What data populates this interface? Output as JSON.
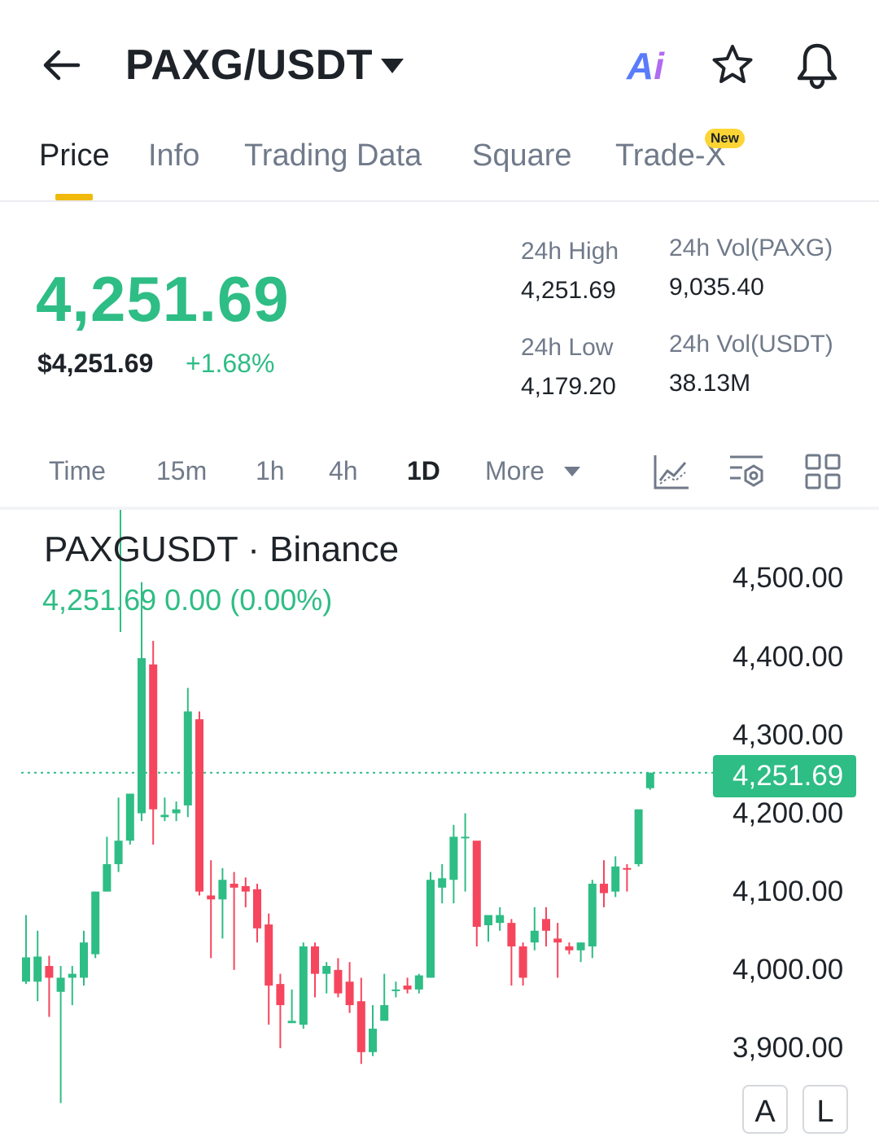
{
  "header": {
    "pair": "PAXG/USDT",
    "ai_label_a": "A",
    "ai_label_i": "i"
  },
  "tabs": [
    {
      "label": "Price",
      "active": true
    },
    {
      "label": "Info"
    },
    {
      "label": "Trading Data"
    },
    {
      "label": "Square"
    },
    {
      "label": "Trade-X",
      "badge": "New"
    }
  ],
  "price": {
    "last": "4,251.69",
    "usd": "$4,251.69",
    "change_pct": "+1.68%"
  },
  "stats": {
    "high_label": "24h High",
    "high_value": "4,251.69",
    "low_label": "24h Low",
    "low_value": "4,179.20",
    "vol_base_label": "24h Vol(PAXG)",
    "vol_base_value": "9,035.40",
    "vol_quote_label": "24h Vol(USDT)",
    "vol_quote_value": "38.13M"
  },
  "timeframes": [
    "Time",
    "15m",
    "1h",
    "4h",
    "1D",
    "More"
  ],
  "active_timeframe": "1D",
  "chart_header": {
    "title": "PAXGUSDT · Binance",
    "subtitle": "4,251.69  0.00 (0.00%)"
  },
  "scale_buttons": [
    "A",
    "L"
  ],
  "colors": {
    "up": "#2ebd85",
    "down": "#f6465d",
    "accent": "#f0b90b",
    "badge": "#fcd535"
  },
  "icons": [
    "back-arrow-icon",
    "caret-down-icon",
    "ai-icon",
    "star-icon",
    "bell-icon",
    "indicator-chart-icon",
    "chart-settings-icon",
    "grid-layout-icon"
  ],
  "chart_data": {
    "type": "candlestick",
    "title": "PAXGUSDT · Binance",
    "y_ticks": [
      "4,500.00",
      "4,400.00",
      "4,300.00",
      "4,200.00",
      "4,100.00",
      "4,000.00",
      "3,900.00"
    ],
    "y_tick_values": [
      4500,
      4400,
      4300,
      4200,
      4100,
      4000,
      3900
    ],
    "last_price_label": "4,251.69",
    "last_price_value": 4251.69,
    "grid": false,
    "candles": [
      {
        "o": 3985,
        "h": 4070,
        "l": 3982,
        "c": 4016
      },
      {
        "o": 3985,
        "h": 4050,
        "l": 3960,
        "c": 4017
      },
      {
        "o": 4005,
        "h": 4018,
        "l": 3940,
        "c": 3990
      },
      {
        "o": 3972,
        "h": 4005,
        "l": 3830,
        "c": 3990
      },
      {
        "o": 3990,
        "h": 4005,
        "l": 3955,
        "c": 3995
      },
      {
        "o": 3990,
        "h": 4050,
        "l": 3980,
        "c": 4035
      },
      {
        "o": 4020,
        "h": 4100,
        "l": 4015,
        "c": 4100
      },
      {
        "o": 4100,
        "h": 4170,
        "l": 4100,
        "c": 4135
      },
      {
        "o": 4135,
        "h": 4220,
        "l": 4125,
        "c": 4165
      },
      {
        "o": 4165,
        "h": 4225,
        "l": 4160,
        "c": 4225
      },
      {
        "o": 4200,
        "h": 4495,
        "l": 4190,
        "c": 4398
      },
      {
        "o": 4390,
        "h": 4420,
        "l": 4160,
        "c": 4205
      },
      {
        "o": 4195,
        "h": 4220,
        "l": 4190,
        "c": 4198
      },
      {
        "o": 4200,
        "h": 4215,
        "l": 4190,
        "c": 4205
      },
      {
        "o": 4210,
        "h": 4360,
        "l": 4195,
        "c": 4330
      },
      {
        "o": 4320,
        "h": 4330,
        "l": 4095,
        "c": 4100
      },
      {
        "o": 4095,
        "h": 4140,
        "l": 4015,
        "c": 4090
      },
      {
        "o": 4090,
        "h": 4130,
        "l": 4040,
        "c": 4115
      },
      {
        "o": 4110,
        "h": 4125,
        "l": 4000,
        "c": 4105
      },
      {
        "o": 4107,
        "h": 4118,
        "l": 4080,
        "c": 4100
      },
      {
        "o": 4103,
        "h": 4110,
        "l": 4035,
        "c": 4053
      },
      {
        "o": 4058,
        "h": 4072,
        "l": 3930,
        "c": 3980
      },
      {
        "o": 3982,
        "h": 3995,
        "l": 3900,
        "c": 3955
      },
      {
        "o": 3932,
        "h": 3975,
        "l": 3935,
        "c": 3935
      },
      {
        "o": 3930,
        "h": 4035,
        "l": 3925,
        "c": 4030
      },
      {
        "o": 4030,
        "h": 4035,
        "l": 3965,
        "c": 3995
      },
      {
        "o": 3995,
        "h": 4010,
        "l": 3970,
        "c": 4005
      },
      {
        "o": 4000,
        "h": 4015,
        "l": 3965,
        "c": 3970
      },
      {
        "o": 3985,
        "h": 4010,
        "l": 3945,
        "c": 3955
      },
      {
        "o": 3960,
        "h": 3990,
        "l": 3880,
        "c": 3895
      },
      {
        "o": 3895,
        "h": 3955,
        "l": 3890,
        "c": 3925
      },
      {
        "o": 3935,
        "h": 3995,
        "l": 3940,
        "c": 3955
      },
      {
        "o": 3975,
        "h": 3985,
        "l": 3965,
        "c": 3975
      },
      {
        "o": 3980,
        "h": 3990,
        "l": 3970,
        "c": 3975
      },
      {
        "o": 3975,
        "h": 3995,
        "l": 3970,
        "c": 3993
      },
      {
        "o": 3990,
        "h": 4125,
        "l": 3990,
        "c": 4115
      },
      {
        "o": 4105,
        "h": 4135,
        "l": 4085,
        "c": 4117
      },
      {
        "o": 4115,
        "h": 4185,
        "l": 4085,
        "c": 4170
      },
      {
        "o": 4170,
        "h": 4200,
        "l": 4100,
        "c": 4170
      },
      {
        "o": 4165,
        "h": 4160,
        "l": 4030,
        "c": 4055
      },
      {
        "o": 4057,
        "h": 4065,
        "l": 4036,
        "c": 4070
      },
      {
        "o": 4060,
        "h": 4080,
        "l": 4050,
        "c": 4070
      },
      {
        "o": 4060,
        "h": 4065,
        "l": 3980,
        "c": 4030
      },
      {
        "o": 4030,
        "h": 4035,
        "l": 3980,
        "c": 3990
      },
      {
        "o": 4035,
        "h": 4080,
        "l": 4025,
        "c": 4050
      },
      {
        "o": 4065,
        "h": 4080,
        "l": 4030,
        "c": 4050
      },
      {
        "o": 4040,
        "h": 4060,
        "l": 3990,
        "c": 4035
      },
      {
        "o": 4030,
        "h": 4035,
        "l": 4020,
        "c": 4025
      },
      {
        "o": 4025,
        "h": 4035,
        "l": 4010,
        "c": 4035
      },
      {
        "o": 4030,
        "h": 4115,
        "l": 4015,
        "c": 4110
      },
      {
        "o": 4110,
        "h": 4140,
        "l": 4080,
        "c": 4098
      },
      {
        "o": 4100,
        "h": 4145,
        "l": 4093,
        "c": 4132
      },
      {
        "o": 4130,
        "h": 4135,
        "l": 4100,
        "c": 4128
      },
      {
        "o": 4135,
        "h": 4200,
        "l": 4132,
        "c": 4205
      },
      {
        "o": 4232,
        "h": 4252,
        "l": 4230,
        "c": 4251.69
      }
    ]
  }
}
